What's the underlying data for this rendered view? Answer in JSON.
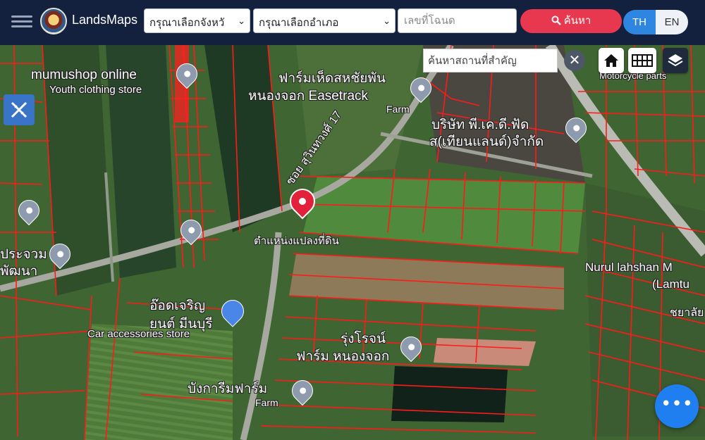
{
  "app": {
    "brand": "LandsMaps"
  },
  "header": {
    "province_select": "กรุณาเลือกจังหวั",
    "district_select": "กรุณาเลือกอำเภอ",
    "deed_placeholder": "เลขที่โฉนด",
    "search_label": "ค้นหา",
    "lang_th": "TH",
    "lang_en": "EN",
    "active_lang": "TH"
  },
  "map_controls": {
    "place_search_placeholder": "ค้นหาสถานที่สำคัญ",
    "clear_label": "✕",
    "fab_label": "•••"
  },
  "map_labels": {
    "mumushop": "mumushop online",
    "mumushop_sub": "Youth clothing store",
    "farm_name_1": "ฟาร์มเห็ดสหชัยพัน",
    "farm_name_2": "หนองจอก Easetrack",
    "farm_sub": "Farm",
    "company_1": "บริษัท พี.เค.ดี.ฟัด",
    "company_2": "ส(เทียนแลนด์)จำกัด",
    "road_name": "ซอย สุวินทวงศ์ 17",
    "parcel_position": "ตำแหน่งแปลงที่ดิน",
    "motorcycle": "Motorcycle parts",
    "nurul_1": "Nurul lahshan M",
    "nurul_2": "(Lamtu",
    "nurul_3": "ชยาลัย",
    "autocare_1": "อ๊อดเจริญ",
    "autocare_2": "ยนต์ มีนบุรี",
    "autocare_sub": "Car accessories store",
    "rungrot_1": "รุ่งโรจน์",
    "rungrot_2": "ฟาร์ม หนองจอก",
    "bangkarim_1": "บังการีมฟาร์ม",
    "bangkarim_sub": "Farm",
    "left_1": "ประจวม",
    "left_2": "พัฒนา"
  },
  "colors": {
    "header_bg": "#13213e",
    "search_btn": "#e8384f",
    "lang_active": "#2f86e0",
    "parcel_lines": "#ff1a1a",
    "fab": "#1f7ff0"
  }
}
